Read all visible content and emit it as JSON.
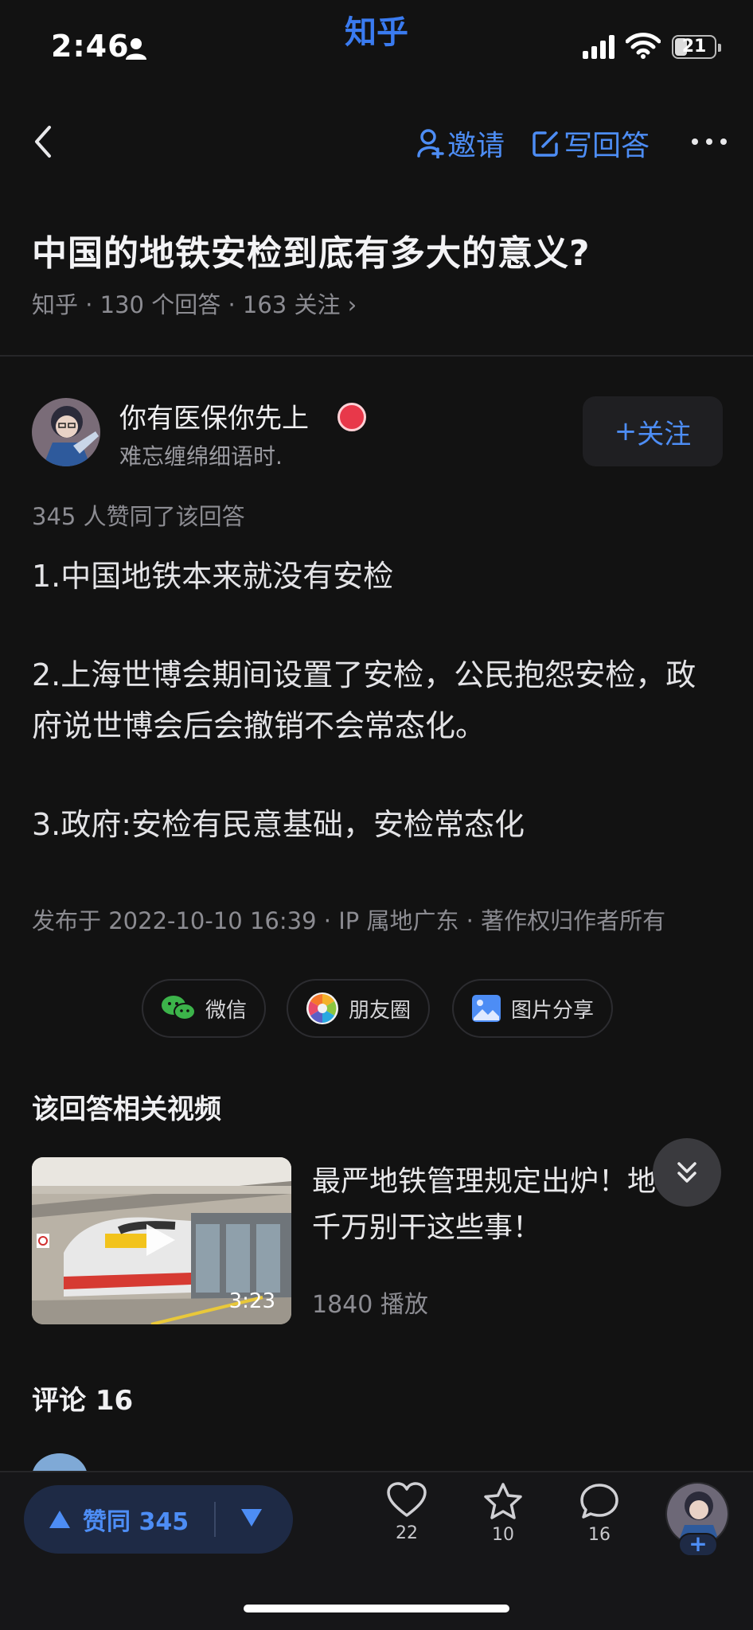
{
  "status_bar": {
    "time": "2:46",
    "app_label": "知乎",
    "battery": "21"
  },
  "nav": {
    "invite_label": "邀请",
    "write_label": "写回答"
  },
  "question": {
    "title": "中国的地铁安检到底有多大的意义?",
    "meta": "知乎 · 130 个回答 · 163 关注"
  },
  "author": {
    "name": "你有医保你先上",
    "bio": "难忘缠绵细语时.",
    "follow_label": "关注"
  },
  "answer": {
    "votes_line": "345 人赞同了该回答",
    "paragraphs": [
      "1.中国地铁本来就没有安检",
      "2.上海世博会期间设置了安检，公民抱怨安检，政府说世博会后会撤销不会常态化。",
      "3.政府:安检有民意基础，安检常态化"
    ],
    "published": "发布于 2022-10-10 16:39 · IP 属地广东 · 著作权归作者所有"
  },
  "share": {
    "wechat": "微信",
    "moments": "朋友圈",
    "image_share": "图片分享"
  },
  "related": {
    "title": "该回答相关视频",
    "video_title": "最严地铁管理规定出炉！地铁上千万别干这些事！",
    "duration": "3:23",
    "plays": "1840 播放"
  },
  "comments": {
    "title": "评论 16"
  },
  "bottom_bar": {
    "upvote_label": "赞同 345",
    "like_count": "22",
    "favorite_count": "10",
    "comment_count": "16",
    "plus": "+"
  },
  "colors": {
    "accent": "#4d8df5",
    "background": "#121212",
    "badge": "#e8384a",
    "wechat": "#3cb34a"
  }
}
